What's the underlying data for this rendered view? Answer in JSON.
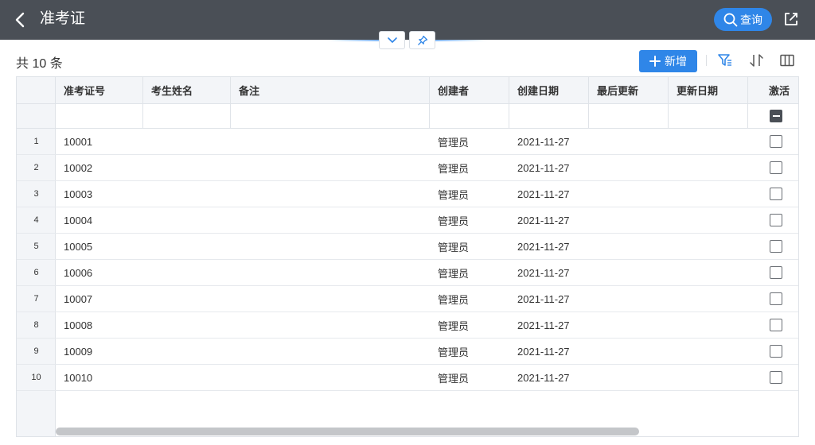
{
  "header": {
    "title": "准考证",
    "query_label": "查询",
    "back_icon": "chevron-left-icon",
    "export_icon": "external-link-icon"
  },
  "toolbar": {
    "count_text": "共 10 条",
    "add_label": "新增",
    "accent_color": "#2f86e8",
    "header_bg": "#4a4f56"
  },
  "grid": {
    "columns": [
      "准考证号",
      "考生姓名",
      "备注",
      "创建者",
      "创建日期",
      "最后更新",
      "更新日期",
      "激活"
    ],
    "rows": [
      {
        "num": "1",
        "id": "10001",
        "name": "",
        "note": "",
        "creator": "管理员",
        "created": "2021-11-27",
        "updater": "",
        "updated": "",
        "active": false
      },
      {
        "num": "2",
        "id": "10002",
        "name": "",
        "note": "",
        "creator": "管理员",
        "created": "2021-11-27",
        "updater": "",
        "updated": "",
        "active": false
      },
      {
        "num": "3",
        "id": "10003",
        "name": "",
        "note": "",
        "creator": "管理员",
        "created": "2021-11-27",
        "updater": "",
        "updated": "",
        "active": false
      },
      {
        "num": "4",
        "id": "10004",
        "name": "",
        "note": "",
        "creator": "管理员",
        "created": "2021-11-27",
        "updater": "",
        "updated": "",
        "active": false
      },
      {
        "num": "5",
        "id": "10005",
        "name": "",
        "note": "",
        "creator": "管理员",
        "created": "2021-11-27",
        "updater": "",
        "updated": "",
        "active": false
      },
      {
        "num": "6",
        "id": "10006",
        "name": "",
        "note": "",
        "creator": "管理员",
        "created": "2021-11-27",
        "updater": "",
        "updated": "",
        "active": false
      },
      {
        "num": "7",
        "id": "10007",
        "name": "",
        "note": "",
        "creator": "管理员",
        "created": "2021-11-27",
        "updater": "",
        "updated": "",
        "active": false
      },
      {
        "num": "8",
        "id": "10008",
        "name": "",
        "note": "",
        "creator": "管理员",
        "created": "2021-11-27",
        "updater": "",
        "updated": "",
        "active": false
      },
      {
        "num": "9",
        "id": "10009",
        "name": "",
        "note": "",
        "creator": "管理员",
        "created": "2021-11-27",
        "updater": "",
        "updated": "",
        "active": false
      },
      {
        "num": "10",
        "id": "10010",
        "name": "",
        "note": "",
        "creator": "管理员",
        "created": "2021-11-27",
        "updater": "",
        "updated": "",
        "active": false
      }
    ]
  }
}
